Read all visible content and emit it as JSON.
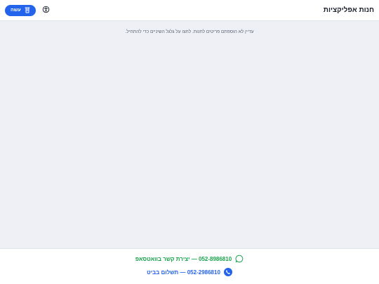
{
  "header": {
    "title": "חנות אפליקציות",
    "cart_button_label": "עשה",
    "accessibility_icon": "accessibility-icon",
    "cart_icon": "cart-icon"
  },
  "main": {
    "empty_message": "עדיין לא הוספתם פריטים לחנות. לחצו על גלגל השיניים כדי להתחיל."
  },
  "footer": {
    "whatsapp_text": "052-8986810 — יצירת קשר בוואטסאפ",
    "phone_text": "052-2986810 — תשלום בביט"
  },
  "colors": {
    "accent": "#2463eb",
    "whatsapp": "#17a34a",
    "background": "#eef0f5"
  }
}
